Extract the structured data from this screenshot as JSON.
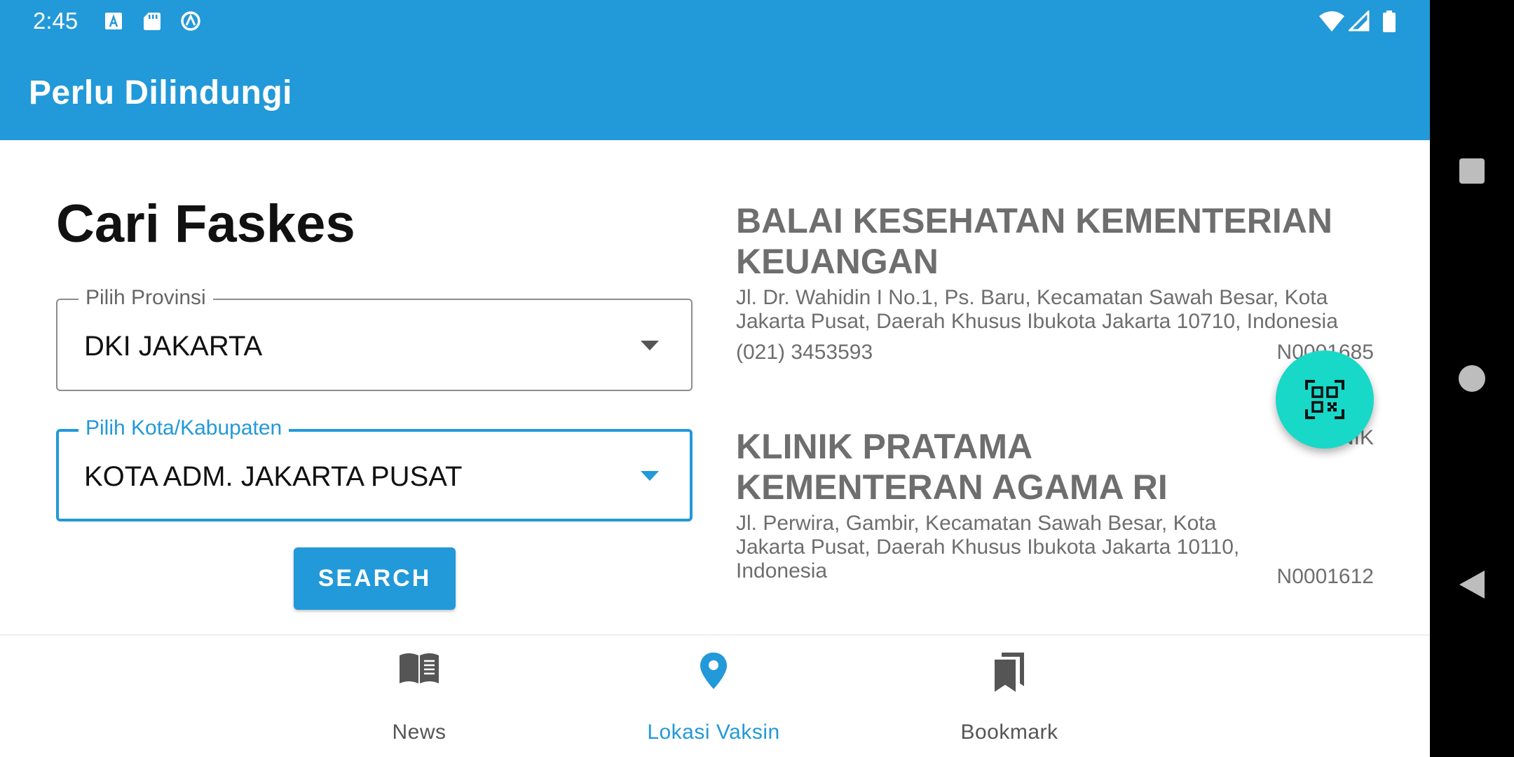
{
  "status_bar": {
    "time": "2:45",
    "left_icons": [
      "a-font-icon",
      "sd-card-icon",
      "circle-a-icon"
    ],
    "right_icons": [
      "wifi-icon",
      "signal-icon",
      "battery-icon"
    ]
  },
  "app_bar": {
    "title": "Perlu Dilindungi"
  },
  "search_panel": {
    "heading": "Cari Faskes",
    "province": {
      "label": "Pilih Provinsi",
      "value": "DKI JAKARTA"
    },
    "city": {
      "label": "Pilih Kota/Kabupaten",
      "value": "KOTA ADM. JAKARTA PUSAT"
    },
    "search_button": "SEARCH"
  },
  "facilities": [
    {
      "name": "BALAI KESEHATAN KEMENTERIAN KEUANGAN",
      "address": "Jl. Dr. Wahidin I No.1, Ps. Baru, Kecamatan Sawah Besar, Kota Jakarta Pusat, Daerah Khusus Ibukota Jakarta 10710, Indonesia",
      "phone": "(021) 3453593",
      "code": "N0001685",
      "type": ""
    },
    {
      "name": "KLINIK PRATAMA KEMENTERAN AGAMA RI",
      "address": "Jl. Perwira, Gambir, Kecamatan Sawah Besar, Kota Jakarta Pusat, Daerah Khusus Ibukota Jakarta 10110, Indonesia",
      "phone": "",
      "code": "N0001612",
      "type": "KLINIK"
    }
  ],
  "fab": {
    "icon": "qr-scan-icon"
  },
  "bottom_nav": {
    "items": [
      {
        "label": "News",
        "icon": "open-book-icon",
        "active": false
      },
      {
        "label": "Lokasi Vaksin",
        "icon": "location-pin-icon",
        "active": true
      },
      {
        "label": "Bookmark",
        "icon": "bookmark-icon",
        "active": false
      }
    ]
  },
  "colors": {
    "primary": "#2299d8",
    "fab": "#18d8c8",
    "text_dark": "#111111",
    "text_muted": "#6e6e6e"
  }
}
